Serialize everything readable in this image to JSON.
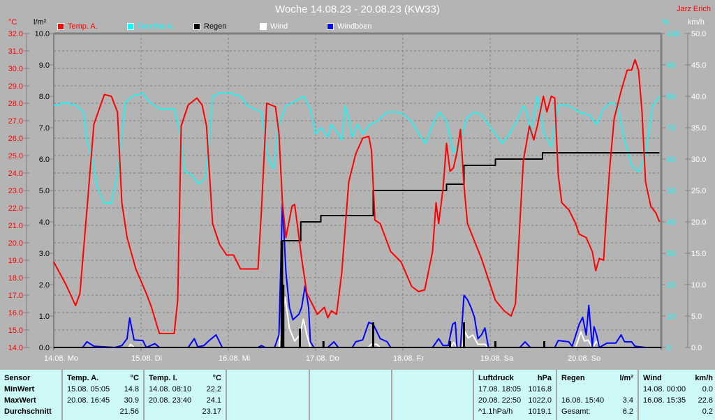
{
  "header": {
    "title": "Woche 14.08.23 - 20.08.23 (KW33)",
    "author": "Jarz Erich"
  },
  "units": {
    "temp": "°C",
    "rain": "l/m²",
    "hum": "%",
    "wind": "km/h"
  },
  "legend": [
    {
      "label": "Temp. A.",
      "color": "#ff0000"
    },
    {
      "label": "Feuchte A.",
      "color": "#00ffff"
    },
    {
      "label": "Regen",
      "color": "#000000"
    },
    {
      "label": "Wind",
      "color": "#ffffff"
    },
    {
      "label": "Windböen",
      "color": "#0000ff"
    }
  ],
  "axes": {
    "temp_ticks": [
      "32.0",
      "31.0",
      "30.0",
      "29.0",
      "28.0",
      "27.0",
      "26.0",
      "25.0",
      "24.0",
      "23.0",
      "22.0",
      "21.0",
      "20.0",
      "19.0",
      "18.0",
      "17.0",
      "16.0",
      "15.0",
      "14.0"
    ],
    "rain_ticks": [
      "10.0",
      "9.0",
      "8.0",
      "7.0",
      "6.0",
      "5.0",
      "4.0",
      "3.0",
      "2.0",
      "1.0",
      "0.0"
    ],
    "hum_ticks": [
      "100",
      "90",
      "80",
      "70",
      "60",
      "50",
      "40",
      "30",
      "20",
      "10",
      "0"
    ],
    "wind_ticks": [
      "50.0",
      "45.0",
      "40.0",
      "35.0",
      "30.0",
      "25.0",
      "20.0",
      "15.0",
      "10.0",
      "5.0",
      "0.0"
    ],
    "days": [
      "14.08.  Mo",
      "15.08.  Di",
      "16.08.  Mi",
      "17.08.  Do",
      "18.08.  Fr",
      "19.08.  Sa",
      "20.08.  So"
    ]
  },
  "chart_data": {
    "type": "line",
    "title": "Woche 14.08.23 - 20.08.23 (KW33)",
    "x_unit": "days since 14.08. 00:00",
    "xlim": [
      0,
      6.94
    ],
    "ylim_temp": [
      14,
      32
    ],
    "ylim_rain": [
      0,
      10
    ],
    "ylim_hum": [
      0,
      100
    ],
    "ylim_wind": [
      0,
      50
    ],
    "grid": true,
    "temp": [
      [
        0,
        18.9
      ],
      [
        0.14,
        17.6
      ],
      [
        0.25,
        16.4
      ],
      [
        0.3,
        17.1
      ],
      [
        0.38,
        21.9
      ],
      [
        0.46,
        26.8
      ],
      [
        0.58,
        28.5
      ],
      [
        0.66,
        28.4
      ],
      [
        0.73,
        27.5
      ],
      [
        0.78,
        22.3
      ],
      [
        0.84,
        20.3
      ],
      [
        0.94,
        18.5
      ],
      [
        1.06,
        17.1
      ],
      [
        1.12,
        16.3
      ],
      [
        1.21,
        14.8
      ],
      [
        1.38,
        14.8
      ],
      [
        1.42,
        16.7
      ],
      [
        1.46,
        26.7
      ],
      [
        1.54,
        27.9
      ],
      [
        1.64,
        28.3
      ],
      [
        1.7,
        27.9
      ],
      [
        1.75,
        26.7
      ],
      [
        1.82,
        21.1
      ],
      [
        1.9,
        19.9
      ],
      [
        1.98,
        19.3
      ],
      [
        2.06,
        19.3
      ],
      [
        2.14,
        18.5
      ],
      [
        2.34,
        18.5
      ],
      [
        2.38,
        21.9
      ],
      [
        2.44,
        28.0
      ],
      [
        2.54,
        27.8
      ],
      [
        2.58,
        26.3
      ],
      [
        2.62,
        22.3
      ],
      [
        2.66,
        20.3
      ],
      [
        2.73,
        22.1
      ],
      [
        2.76,
        22.2
      ],
      [
        2.81,
        20.3
      ],
      [
        2.84,
        19.1
      ],
      [
        2.9,
        17.1
      ],
      [
        3.02,
        15.9
      ],
      [
        3.1,
        16.3
      ],
      [
        3.14,
        15.7
      ],
      [
        3.18,
        16.1
      ],
      [
        3.24,
        15.9
      ],
      [
        3.3,
        18.3
      ],
      [
        3.38,
        23.5
      ],
      [
        3.46,
        25.1
      ],
      [
        3.54,
        26.0
      ],
      [
        3.61,
        26.1
      ],
      [
        3.64,
        25.3
      ],
      [
        3.68,
        21.3
      ],
      [
        3.74,
        21.1
      ],
      [
        3.86,
        19.5
      ],
      [
        3.98,
        18.9
      ],
      [
        4.1,
        17.5
      ],
      [
        4.18,
        17.2
      ],
      [
        4.25,
        17.3
      ],
      [
        4.34,
        19.5
      ],
      [
        4.38,
        22.3
      ],
      [
        4.41,
        21.1
      ],
      [
        4.46,
        23.1
      ],
      [
        4.5,
        25.7
      ],
      [
        4.54,
        24.1
      ],
      [
        4.58,
        24.3
      ],
      [
        4.62,
        25.2
      ],
      [
        4.66,
        26.5
      ],
      [
        4.7,
        23.3
      ],
      [
        4.74,
        21.1
      ],
      [
        4.82,
        20.1
      ],
      [
        4.9,
        19.1
      ],
      [
        4.98,
        17.9
      ],
      [
        5.06,
        16.7
      ],
      [
        5.16,
        16.1
      ],
      [
        5.24,
        15.8
      ],
      [
        5.29,
        16.5
      ],
      [
        5.34,
        21.1
      ],
      [
        5.38,
        24.7
      ],
      [
        5.45,
        26.7
      ],
      [
        5.5,
        25.9
      ],
      [
        5.54,
        26.7
      ],
      [
        5.61,
        28.4
      ],
      [
        5.65,
        27.5
      ],
      [
        5.7,
        28.4
      ],
      [
        5.74,
        28.3
      ],
      [
        5.78,
        23.9
      ],
      [
        5.82,
        22.3
      ],
      [
        5.9,
        21.9
      ],
      [
        5.98,
        21.1
      ],
      [
        6.02,
        20.5
      ],
      [
        6.1,
        20.3
      ],
      [
        6.17,
        19.5
      ],
      [
        6.21,
        18.4
      ],
      [
        6.25,
        19.1
      ],
      [
        6.3,
        19.0
      ],
      [
        6.33,
        21.5
      ],
      [
        6.37,
        24.3
      ],
      [
        6.42,
        27.1
      ],
      [
        6.5,
        28.7
      ],
      [
        6.57,
        29.9
      ],
      [
        6.62,
        29.9
      ],
      [
        6.66,
        30.5
      ],
      [
        6.7,
        29.9
      ],
      [
        6.74,
        27.5
      ],
      [
        6.78,
        23.5
      ],
      [
        6.84,
        22.1
      ],
      [
        6.9,
        21.7
      ],
      [
        6.94,
        21.2
      ]
    ],
    "humidity": [
      [
        0,
        77
      ],
      [
        0.14,
        78
      ],
      [
        0.26,
        77
      ],
      [
        0.34,
        75
      ],
      [
        0.38,
        66
      ],
      [
        0.44,
        60
      ],
      [
        0.5,
        51
      ],
      [
        0.58,
        46
      ],
      [
        0.66,
        46
      ],
      [
        0.73,
        55
      ],
      [
        0.78,
        68
      ],
      [
        0.82,
        78
      ],
      [
        0.9,
        80
      ],
      [
        1.02,
        81
      ],
      [
        1.1,
        78
      ],
      [
        1.22,
        76
      ],
      [
        1.38,
        76
      ],
      [
        1.45,
        68
      ],
      [
        1.5,
        56
      ],
      [
        1.58,
        55
      ],
      [
        1.66,
        52
      ],
      [
        1.74,
        54
      ],
      [
        1.78,
        66
      ],
      [
        1.82,
        80
      ],
      [
        1.9,
        81
      ],
      [
        2.02,
        81
      ],
      [
        2.14,
        80
      ],
      [
        2.22,
        77
      ],
      [
        2.3,
        76
      ],
      [
        2.38,
        75
      ],
      [
        2.46,
        60
      ],
      [
        2.52,
        57
      ],
      [
        2.58,
        71
      ],
      [
        2.66,
        77
      ],
      [
        2.74,
        78
      ],
      [
        2.86,
        80
      ],
      [
        2.94,
        76
      ],
      [
        3.0,
        68
      ],
      [
        3.06,
        70
      ],
      [
        3.14,
        67
      ],
      [
        3.18,
        71
      ],
      [
        3.26,
        68
      ],
      [
        3.3,
        66
      ],
      [
        3.34,
        77
      ],
      [
        3.38,
        73
      ],
      [
        3.42,
        67
      ],
      [
        3.48,
        71
      ],
      [
        3.54,
        68
      ],
      [
        3.62,
        71
      ],
      [
        3.7,
        72
      ],
      [
        3.82,
        75
      ],
      [
        3.94,
        75
      ],
      [
        4.02,
        74
      ],
      [
        4.1,
        72
      ],
      [
        4.18,
        68
      ],
      [
        4.26,
        65
      ],
      [
        4.34,
        71
      ],
      [
        4.42,
        75
      ],
      [
        4.5,
        72
      ],
      [
        4.58,
        62
      ],
      [
        4.66,
        66
      ],
      [
        4.73,
        73
      ],
      [
        4.82,
        75
      ],
      [
        4.9,
        74
      ],
      [
        4.98,
        71
      ],
      [
        5.06,
        68
      ],
      [
        5.14,
        65
      ],
      [
        5.22,
        68
      ],
      [
        5.3,
        72
      ],
      [
        5.38,
        77
      ],
      [
        5.42,
        75
      ],
      [
        5.46,
        68
      ],
      [
        5.54,
        80
      ],
      [
        5.62,
        68
      ],
      [
        5.7,
        64
      ],
      [
        5.78,
        77
      ],
      [
        5.9,
        77
      ],
      [
        6.02,
        75
      ],
      [
        6.14,
        74
      ],
      [
        6.22,
        71
      ],
      [
        6.3,
        76
      ],
      [
        6.38,
        78
      ],
      [
        6.46,
        77
      ],
      [
        6.54,
        66
      ],
      [
        6.62,
        58
      ],
      [
        6.7,
        56
      ],
      [
        6.78,
        61
      ],
      [
        6.86,
        77
      ],
      [
        6.94,
        80
      ]
    ],
    "rain_total": [
      [
        0,
        0
      ],
      [
        2.62,
        3.4
      ],
      [
        2.83,
        4.0
      ],
      [
        3.06,
        4.2
      ],
      [
        3.66,
        5.0
      ],
      [
        4.5,
        5.2
      ],
      [
        4.7,
        5.8
      ],
      [
        5.06,
        6.0
      ],
      [
        5.6,
        6.2
      ],
      [
        6.94,
        6.2
      ]
    ],
    "rain_bars": [
      [
        2.61,
        3.4
      ],
      [
        2.63,
        2.0
      ],
      [
        2.82,
        0.6
      ],
      [
        3.09,
        0.2
      ],
      [
        3.66,
        0.8
      ],
      [
        4.54,
        0.2
      ],
      [
        4.7,
        0.8
      ],
      [
        5.06,
        0.2
      ],
      [
        5.62,
        0.2
      ]
    ],
    "wind": [
      [
        0,
        0
      ],
      [
        0.86,
        0
      ],
      [
        0.88,
        0.5
      ],
      [
        0.92,
        0
      ],
      [
        2.58,
        0
      ],
      [
        2.62,
        5
      ],
      [
        2.65,
        8
      ],
      [
        2.7,
        3
      ],
      [
        2.76,
        1
      ],
      [
        2.82,
        2
      ],
      [
        2.86,
        4.5
      ],
      [
        2.9,
        2
      ],
      [
        2.94,
        0
      ],
      [
        3.6,
        0
      ],
      [
        3.64,
        0.5
      ],
      [
        3.7,
        0.5
      ],
      [
        3.74,
        0
      ],
      [
        4.55,
        0
      ],
      [
        4.58,
        0.8
      ],
      [
        4.62,
        0
      ],
      [
        4.68,
        0
      ],
      [
        4.71,
        2.5
      ],
      [
        4.75,
        1.5
      ],
      [
        4.8,
        2
      ],
      [
        4.86,
        0.5
      ],
      [
        4.94,
        0.5
      ],
      [
        4.98,
        0
      ],
      [
        5.98,
        0
      ],
      [
        6.04,
        2.5
      ],
      [
        6.08,
        1
      ],
      [
        6.12,
        1.2
      ],
      [
        6.17,
        0
      ],
      [
        6.22,
        1
      ],
      [
        6.26,
        0
      ],
      [
        6.94,
        0
      ]
    ],
    "gusts": [
      [
        0,
        0
      ],
      [
        0.33,
        0
      ],
      [
        0.38,
        0.9
      ],
      [
        0.46,
        0.2
      ],
      [
        0.7,
        0
      ],
      [
        0.78,
        0.3
      ],
      [
        0.84,
        1.4
      ],
      [
        0.87,
        4.7
      ],
      [
        0.92,
        1.2
      ],
      [
        1.02,
        1.1
      ],
      [
        1.06,
        0
      ],
      [
        1.16,
        0.6
      ],
      [
        1.21,
        0
      ],
      [
        1.54,
        0
      ],
      [
        1.61,
        1.4
      ],
      [
        1.65,
        0.1
      ],
      [
        1.72,
        0.3
      ],
      [
        1.78,
        1.1
      ],
      [
        1.86,
        2.0
      ],
      [
        1.93,
        0
      ],
      [
        2.34,
        0
      ],
      [
        2.38,
        0.3
      ],
      [
        2.42,
        0
      ],
      [
        2.53,
        0
      ],
      [
        2.58,
        2.0
      ],
      [
        2.62,
        23.1
      ],
      [
        2.66,
        12.0
      ],
      [
        2.7,
        6.4
      ],
      [
        2.74,
        4.4
      ],
      [
        2.81,
        5.3
      ],
      [
        2.84,
        6.4
      ],
      [
        2.88,
        9.8
      ],
      [
        2.92,
        6.4
      ],
      [
        2.94,
        0.9
      ],
      [
        2.98,
        0
      ],
      [
        3.14,
        0
      ],
      [
        3.21,
        0.9
      ],
      [
        3.26,
        0
      ],
      [
        3.42,
        0
      ],
      [
        3.46,
        0.9
      ],
      [
        3.54,
        1.2
      ],
      [
        3.61,
        4.0
      ],
      [
        3.66,
        3.7
      ],
      [
        3.74,
        1.4
      ],
      [
        3.82,
        0.9
      ],
      [
        3.86,
        0
      ],
      [
        4.34,
        0
      ],
      [
        4.41,
        1.4
      ],
      [
        4.46,
        0.3
      ],
      [
        4.52,
        0.3
      ],
      [
        4.57,
        3.7
      ],
      [
        4.6,
        4.0
      ],
      [
        4.62,
        0
      ],
      [
        4.66,
        0
      ],
      [
        4.7,
        8.3
      ],
      [
        4.74,
        7.6
      ],
      [
        4.78,
        6.4
      ],
      [
        4.82,
        4.8
      ],
      [
        4.86,
        1.4
      ],
      [
        4.9,
        2.0
      ],
      [
        4.94,
        3.1
      ],
      [
        4.98,
        0
      ],
      [
        5.34,
        0
      ],
      [
        5.4,
        0.9
      ],
      [
        5.46,
        0
      ],
      [
        5.74,
        0
      ],
      [
        5.78,
        1.1
      ],
      [
        5.9,
        0.9
      ],
      [
        5.94,
        0.2
      ],
      [
        6.02,
        3.7
      ],
      [
        6.06,
        4.8
      ],
      [
        6.1,
        2.0
      ],
      [
        6.13,
        6.7
      ],
      [
        6.17,
        0
      ],
      [
        6.19,
        3.3
      ],
      [
        6.22,
        2.0
      ],
      [
        6.25,
        0
      ],
      [
        6.34,
        0.7
      ],
      [
        6.44,
        0.7
      ],
      [
        6.5,
        2.0
      ],
      [
        6.54,
        0.9
      ],
      [
        6.62,
        0.9
      ],
      [
        6.66,
        0.2
      ],
      [
        6.78,
        0
      ],
      [
        6.94,
        0
      ]
    ]
  },
  "table": {
    "row_labels": [
      "Sensor",
      "MinWert",
      "MaxWert",
      "Durchschnitt"
    ],
    "temp_a": {
      "title": "Temp. A.",
      "unit": "°C",
      "min_time": "15.08.  05:05",
      "min": "14.8",
      "max_time": "20.08.  16:45",
      "max": "30.9",
      "avg": "21.56"
    },
    "temp_i": {
      "title": "Temp. I.",
      "unit": "°C",
      "min_time": "14.08.  08:10",
      "min": "22.2",
      "max_time": "20.08.  23:40",
      "max": "24.1",
      "avg": "23.17"
    },
    "pressure": {
      "title": "Luftdruck",
      "unit": "hPa",
      "min_time": "17.08.  18:05",
      "min": "1016.8",
      "max_time": "20.08.  22:50",
      "max": "1022.0",
      "trend": "^1.1hPa/h",
      "avg": "1019.1"
    },
    "rain": {
      "title": "Regen",
      "unit": "l/m²",
      "max_time": "16.08.  15:40",
      "max": "3.4",
      "total_label": "Gesamt:",
      "total": "6.2"
    },
    "wind": {
      "title": "Wind",
      "unit": "km/h",
      "min_time": "14.08.  00:00",
      "min": "0.0",
      "max_time": "16.08.  15:35",
      "max": "22.8",
      "avg": "0.2"
    }
  }
}
